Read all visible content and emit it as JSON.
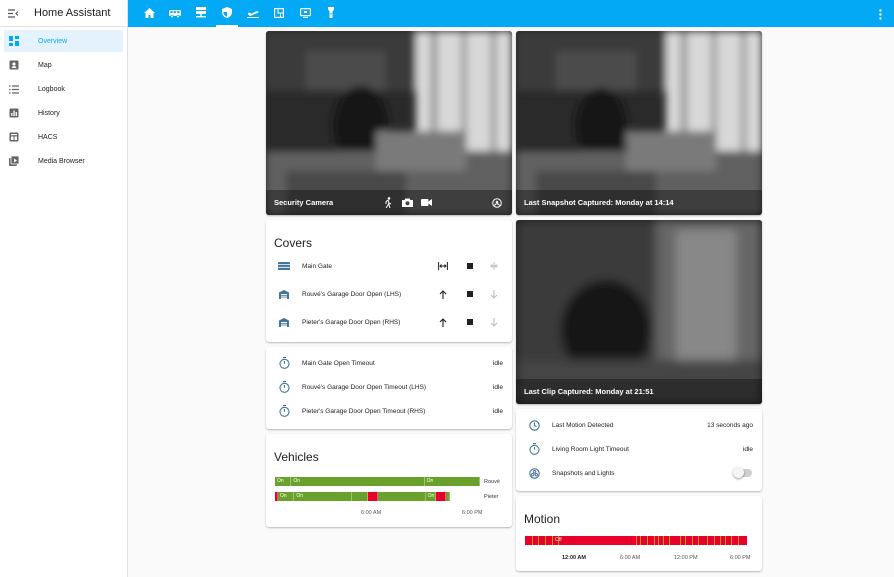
{
  "app": {
    "title": "Home Assistant"
  },
  "sidebar": {
    "items": [
      {
        "label": "Overview",
        "icon": "overview-icon",
        "active": true
      },
      {
        "label": "Map",
        "icon": "map-icon"
      },
      {
        "label": "Logbook",
        "icon": "logbook-icon"
      },
      {
        "label": "History",
        "icon": "history-icon"
      },
      {
        "label": "HACS",
        "icon": "hacs-icon"
      },
      {
        "label": "Media Browser",
        "icon": "media-browser-icon"
      }
    ]
  },
  "topbar": {
    "tabs": [
      "home-icon",
      "bus-icon",
      "server-icon",
      "shield-icon",
      "plane-icon",
      "grid-icon",
      "monitor-icon",
      "flashlight-icon"
    ],
    "active_tab": 3
  },
  "cameras": {
    "security": {
      "label": "Security Camera"
    },
    "snapshot": {
      "label": "Last Snapshot Captured: Monday at 14:14"
    },
    "clip": {
      "label": "Last Clip Captured: Monday at 21:51"
    }
  },
  "covers": {
    "title": "Covers",
    "items": [
      {
        "label": "Main Gate"
      },
      {
        "label": "Rouvé's Garage Door Open (LHS)"
      },
      {
        "label": "Pieter's Garage Door Open (RHS)"
      }
    ]
  },
  "timers": {
    "items": [
      {
        "label": "Main Gate Open Timeout",
        "value": "idle"
      },
      {
        "label": "Rouvé's Garage Door Open Timeout (LHS)",
        "value": "idle"
      },
      {
        "label": "Pieter's Garage Door Open Timeout (RHS)",
        "value": "idle"
      }
    ]
  },
  "vehicles": {
    "title": "Vehicles",
    "rows": [
      {
        "name": "Rouvé",
        "segments": [
          {
            "state": "On",
            "frac": 0.08,
            "color": "#6aa12a"
          },
          {
            "state": "On",
            "frac": 0.65,
            "color": "#6aa12a"
          },
          {
            "state": "On",
            "frac": 0.27,
            "color": "#6aa12a"
          }
        ]
      },
      {
        "name": "Pieter",
        "segments": [
          {
            "state": "",
            "frac": 0.01,
            "color": "#e8002b"
          },
          {
            "state": "On",
            "frac": 0.08,
            "color": "#6aa12a"
          },
          {
            "state": "On",
            "frac": 0.28,
            "color": "#6aa12a"
          },
          {
            "state": "",
            "frac": 0.08,
            "color": "#6aa12a"
          },
          {
            "state": "",
            "frac": 0.05,
            "color": "#e8002b"
          },
          {
            "state": "",
            "frac": 0.23,
            "color": "#6aa12a"
          },
          {
            "state": "On",
            "frac": 0.05,
            "color": "#6aa12a"
          },
          {
            "state": "",
            "frac": 0.05,
            "color": "#e8002b"
          },
          {
            "state": "",
            "frac": 0.02,
            "color": "#6aa12a"
          }
        ]
      }
    ],
    "axis": [
      "6:00 AM",
      "6:00 PM"
    ]
  },
  "motion_entities": {
    "items": [
      {
        "label": "Last Motion Detected",
        "value": "13 seconds ago",
        "icon": "clock-icon"
      },
      {
        "label": "Living Room Light Timeout",
        "value": "idle",
        "icon": "timer-icon"
      },
      {
        "label": "Snapshots and Lights",
        "value": "",
        "icon": "snapshot-icon"
      }
    ]
  },
  "motion": {
    "title": "Motion",
    "bar": {
      "state": "Off",
      "base_color": "#e8002b",
      "on_color": "#b79a1f"
    },
    "axis": [
      "12:00 AM",
      "6:00 AM",
      "12:00 PM",
      "6:00 PM"
    ]
  }
}
